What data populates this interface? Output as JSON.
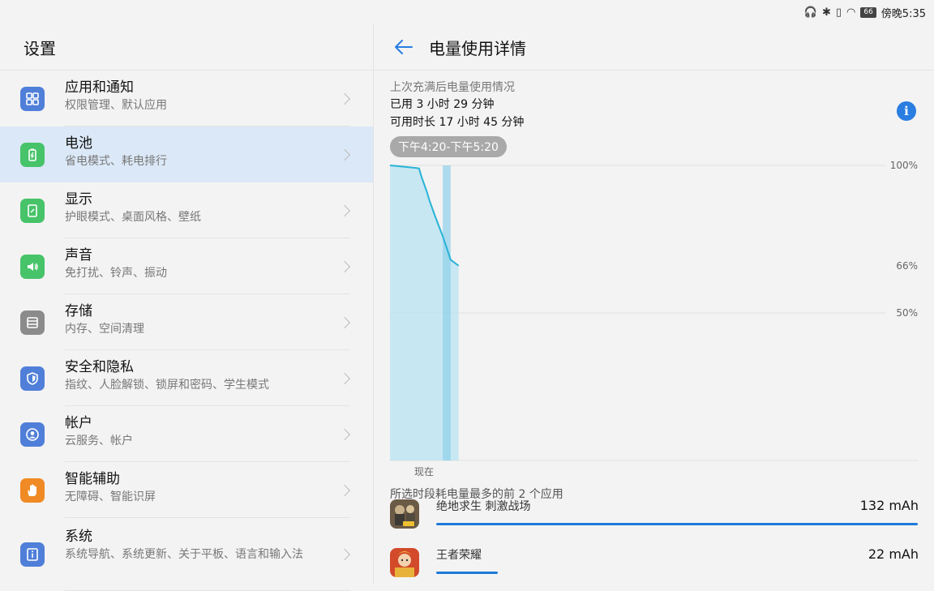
{
  "status_bar": {
    "time": "傍晚5:35",
    "battery_level": "66",
    "icons": [
      "headphones-icon",
      "bluetooth-icon",
      "vibrate-icon",
      "wifi-icon",
      "battery-icon"
    ]
  },
  "settings": {
    "title": "设置",
    "items": [
      {
        "name": "apps-notifications",
        "title": "应用和通知",
        "sub": "权限管理、默认应用",
        "icon": "apps-grid-icon",
        "color": "#4f7fd8"
      },
      {
        "name": "battery",
        "title": "电池",
        "sub": "省电模式、耗电排行",
        "icon": "battery-icon",
        "color": "#47c36a",
        "selected": true
      },
      {
        "name": "display",
        "title": "显示",
        "sub": "护眼模式、桌面风格、壁纸",
        "icon": "display-icon",
        "color": "#47c36a"
      },
      {
        "name": "sound",
        "title": "声音",
        "sub": "免打扰、铃声、振动",
        "icon": "speaker-icon",
        "color": "#47c36a"
      },
      {
        "name": "storage",
        "title": "存储",
        "sub": "内存、空间清理",
        "icon": "storage-icon",
        "color": "#8b8b8b"
      },
      {
        "name": "security-privacy",
        "title": "安全和隐私",
        "sub": "指纹、人脸解锁、锁屏和密码、学生模式",
        "icon": "shield-icon",
        "color": "#4f7fd8"
      },
      {
        "name": "accounts",
        "title": "帐户",
        "sub": "云服务、帐户",
        "icon": "account-icon",
        "color": "#4f7fd8"
      },
      {
        "name": "smart-assist",
        "title": "智能辅助",
        "sub": "无障碍、智能识屏",
        "icon": "hand-icon",
        "color": "#f08a24"
      },
      {
        "name": "system",
        "title": "系统",
        "sub": "系统导航、系统更新、关于平板、语言和输入法",
        "icon": "system-info-icon",
        "color": "#4f7fd8"
      }
    ]
  },
  "detail": {
    "title": "电量使用详情",
    "since_label": "上次充满后电量使用情况",
    "used": "已用 3 小时 29 分钟",
    "available": "可用时长 17 小时 45 分钟",
    "range": "下午4:20-下午5:20",
    "now_label": "现在",
    "top_apps_title": "所选时段耗电量最多的前 2 个应用",
    "apps": [
      {
        "name": "绝地求生 刺激战场",
        "usage": "132 mAh",
        "share": 1.0,
        "icon": "pubg-game-icon"
      },
      {
        "name": "王者荣耀",
        "usage": "22 mAh",
        "share": 0.1273,
        "icon": "honor-of-kings-game-icon"
      }
    ]
  },
  "chart_data": {
    "type": "area",
    "y_tick_labels": [
      "100%",
      "66%",
      "50%"
    ],
    "ylim": [
      0,
      100
    ],
    "x_label": "现在",
    "series": [
      {
        "x": [
          0.0,
          0.3,
          0.55,
          0.6,
          0.7,
          0.75,
          0.85,
          1.0,
          1.15,
          1.3
        ],
        "y": [
          100,
          99.5,
          99,
          96,
          91,
          88,
          83,
          76,
          68,
          66
        ]
      }
    ],
    "x_range": [
      0,
      10
    ],
    "highlight_x": [
      1.0,
      1.15
    ],
    "line_color": "#27b3d6",
    "fill_color": "#b8e3f3"
  }
}
